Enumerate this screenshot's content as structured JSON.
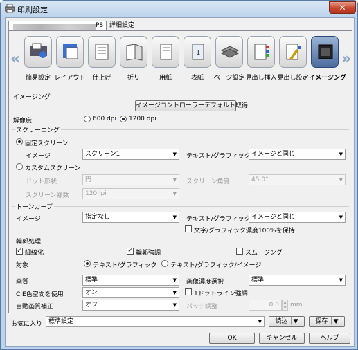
{
  "window": {
    "title": "印刷設定",
    "close": "✕"
  },
  "tabs": [
    {
      "label": "PS"
    },
    {
      "label": "詳細設定"
    }
  ],
  "toolbar": {
    "items": [
      {
        "label": "簡易設定",
        "icon": "quick-settings-icon"
      },
      {
        "label": "レイアウト",
        "icon": "layout-icon"
      },
      {
        "label": "仕上げ",
        "icon": "finishing-icon"
      },
      {
        "label": "折り",
        "icon": "fold-icon"
      },
      {
        "label": "用紙",
        "icon": "paper-icon"
      },
      {
        "label": "表紙",
        "icon": "cover-icon"
      },
      {
        "label": "ページ設定",
        "icon": "page-settings-icon"
      },
      {
        "label": "見出し挿入",
        "icon": "tab-insert-icon"
      },
      {
        "label": "見出し設定",
        "icon": "tab-settings-icon"
      },
      {
        "label": "イメージング",
        "icon": "imaging-icon"
      }
    ],
    "left_arrow": "«",
    "right_arrow": "»"
  },
  "imaging": {
    "group_title": "イメージング",
    "controller_default_button": "イメージコントローラーデフォルト取得",
    "resolution_label": "解像度",
    "res_600": "600 dpi",
    "res_1200": "1200 dpi",
    "selected_resolution": "1200 dpi"
  },
  "screening": {
    "group_title": "スクリーニング",
    "fixed_screen": "固定スクリーン",
    "image_label": "イメージ",
    "image_value": "スクリーン1",
    "text_graphic_label": "テキスト/グラフィック",
    "text_graphic_value": "イメージと同じ",
    "custom_screen": "カスタムスクリーン",
    "dot_shape_label": "ドット形状",
    "dot_shape_value": "円",
    "screen_angle_label": "スクリーン角度",
    "screen_angle_value": "45.0°",
    "screen_lines_label": "スクリーン線数",
    "screen_lines_value": "120 lpi"
  },
  "tone_curve": {
    "group_title": "トーンカーブ",
    "image_label": "イメージ",
    "image_value": "指定なし",
    "text_graphic_label": "テキスト/グラフィック",
    "text_graphic_value": "イメージと同じ",
    "keep_density": "文字/グラフィック濃度100%を保持"
  },
  "outline": {
    "group_title": "輪郭処理",
    "thinning": "細線化",
    "edge_enhance": "輪郭強調",
    "smoothing": "スムージング",
    "target_label": "対象",
    "target_text": "テキスト/グラフィック",
    "target_text_image": "テキスト/グラフィック/イメージ"
  },
  "quality": {
    "quality_label": "画質",
    "quality_value": "標準",
    "density_label": "画像濃度選択",
    "density_value": "標準",
    "cie_label": "CIE色空間を使用",
    "cie_value": "オン",
    "one_dot_line": "1ドットライン強調",
    "auto_label": "自動画質補正",
    "auto_value": "オフ",
    "patch_label": "パッチ調整",
    "patch_value": "0.0",
    "patch_unit": "mm"
  },
  "footer": {
    "favorites_label": "お気に入り",
    "favorites_value": "標準設定",
    "load": "読込",
    "save": "保存",
    "ok": "OK",
    "cancel": "キャンセル",
    "help": "ヘルプ"
  },
  "colors": {
    "selected_tab": "#3a5d92",
    "title_bar": "#bcd3ea"
  }
}
